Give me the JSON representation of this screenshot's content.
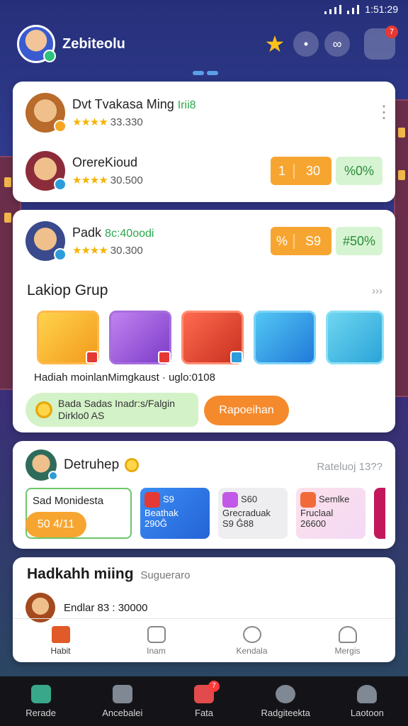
{
  "status_bar": {
    "time": "1:51:29"
  },
  "header": {
    "username": "Zebiteolu",
    "notification_count": "7"
  },
  "card1": {
    "players": [
      {
        "name": "Dvt Tvakasa Ming",
        "name_highlight": "Irii8",
        "rating": "33.330",
        "avatar_color": "#b86b2a",
        "badge_color": "#f5a623"
      },
      {
        "name": "OrereKioud",
        "name_highlight": "",
        "rating": "30.500",
        "avatar_color": "#8c2c3a",
        "badge_color": "#2d9cdb",
        "pill_a": "1",
        "pill_b": "30",
        "pill_green": "%0%"
      }
    ]
  },
  "card2": {
    "player": {
      "name": "Padk",
      "name_highlight": "8c:40oodi",
      "rating": "30.300",
      "avatar_color": "#3a4a8c",
      "badge_color": "#2d9cdb",
      "pill_a": "%",
      "pill_b": "S9",
      "pill_green": "#50%"
    },
    "section_title": "Lakiop Grup",
    "section_more": "›››",
    "games": [
      {
        "name": "gift-game-tile",
        "tag_color": "#e53935"
      },
      {
        "name": "character-game-tile",
        "tag_color": "#e53935"
      },
      {
        "name": "crown-game-tile",
        "tag_color": "#2d9cdb"
      },
      {
        "name": "treasure-game-tile",
        "tag_color": "#2d9cdb"
      },
      {
        "name": "chest-game-tile",
        "tag_color": ""
      }
    ],
    "game_caption": "Hadiah moinlanMimgkaust  ·  uglo:0108",
    "promo_line1": "Bada Sadas Inadr:s/Falgin",
    "promo_line2": "Dirklo0 AS",
    "promo_button": "Rapoeihan"
  },
  "card3": {
    "title": "Detruhep",
    "more": "Rateluoj 13??",
    "offer_main_title": "Sad Monidesta",
    "offer_main_value": "50 4/11",
    "offers": [
      {
        "line1": "S9",
        "line2": "Beathak",
        "line3": "290Ĝ"
      },
      {
        "line1": "S60",
        "line2": "Grecraduak",
        "line3": "S9 Ĝ88"
      },
      {
        "line1": "Semlke",
        "line2": "Fruclaal",
        "line3": "26600"
      }
    ]
  },
  "card4": {
    "title": "Hadkahh miing",
    "subtitle": "Sugueraro",
    "row_text": "Endlar 83 : 30000"
  },
  "inner_nav": [
    {
      "label": "Habit",
      "icon": "home-icon"
    },
    {
      "label": "Inam",
      "icon": "gift-icon"
    },
    {
      "label": "Kendala",
      "icon": "search-icon"
    },
    {
      "label": "Mergis",
      "icon": "profile-icon"
    }
  ],
  "bottom_nav": [
    {
      "label": "Rerade",
      "icon": "home-icon"
    },
    {
      "label": "Ancebalei",
      "icon": "inbox-icon"
    },
    {
      "label": "Fata",
      "icon": "wallet-icon",
      "badge": "7"
    },
    {
      "label": "Radgiteekta",
      "icon": "clock-icon"
    },
    {
      "label": "Laotoon",
      "icon": "user-icon"
    }
  ]
}
